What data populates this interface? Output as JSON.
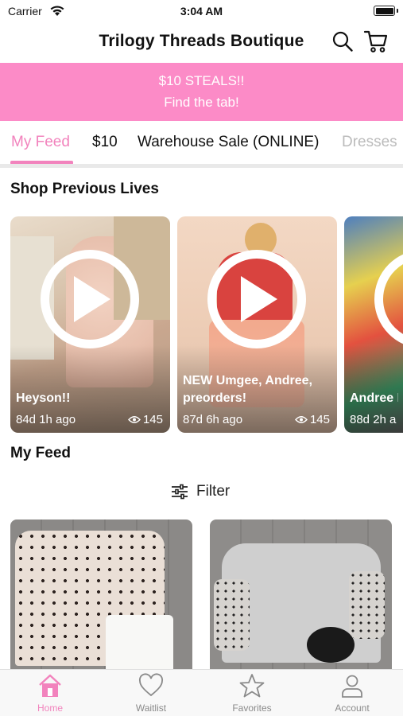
{
  "status_bar": {
    "carrier": "Carrier",
    "time": "3:04 AM"
  },
  "header": {
    "title": "Trilogy Threads Boutique"
  },
  "banner": {
    "line1": "$10 STEALS!!",
    "line2": "Find the tab!"
  },
  "tabs": [
    {
      "label": "My Feed",
      "active": true
    },
    {
      "label": "$10"
    },
    {
      "label": "Warehouse Sale (ONLINE)"
    },
    {
      "label": "Dresses"
    }
  ],
  "lives": {
    "title": "Shop Previous Lives",
    "items": [
      {
        "title": "Heyson!!",
        "age": "84d 1h ago",
        "views": "145"
      },
      {
        "title": "NEW Umgee, Andree, preorders!",
        "age": "87d 6h ago",
        "views": "145"
      },
      {
        "title": "Andree N",
        "age": "88d 2h a",
        "views": ""
      }
    ]
  },
  "feed": {
    "title": "My Feed",
    "filter_label": "Filter"
  },
  "bottom_nav": [
    {
      "label": "Home",
      "icon": "home-icon",
      "active": true
    },
    {
      "label": "Waitlist",
      "icon": "heart-icon"
    },
    {
      "label": "Favorites",
      "icon": "star-icon"
    },
    {
      "label": "Account",
      "icon": "person-icon"
    }
  ],
  "colors": {
    "accent": "#f283bd",
    "banner": "#fc8bc7",
    "nav_inactive": "#8a8a8a"
  }
}
